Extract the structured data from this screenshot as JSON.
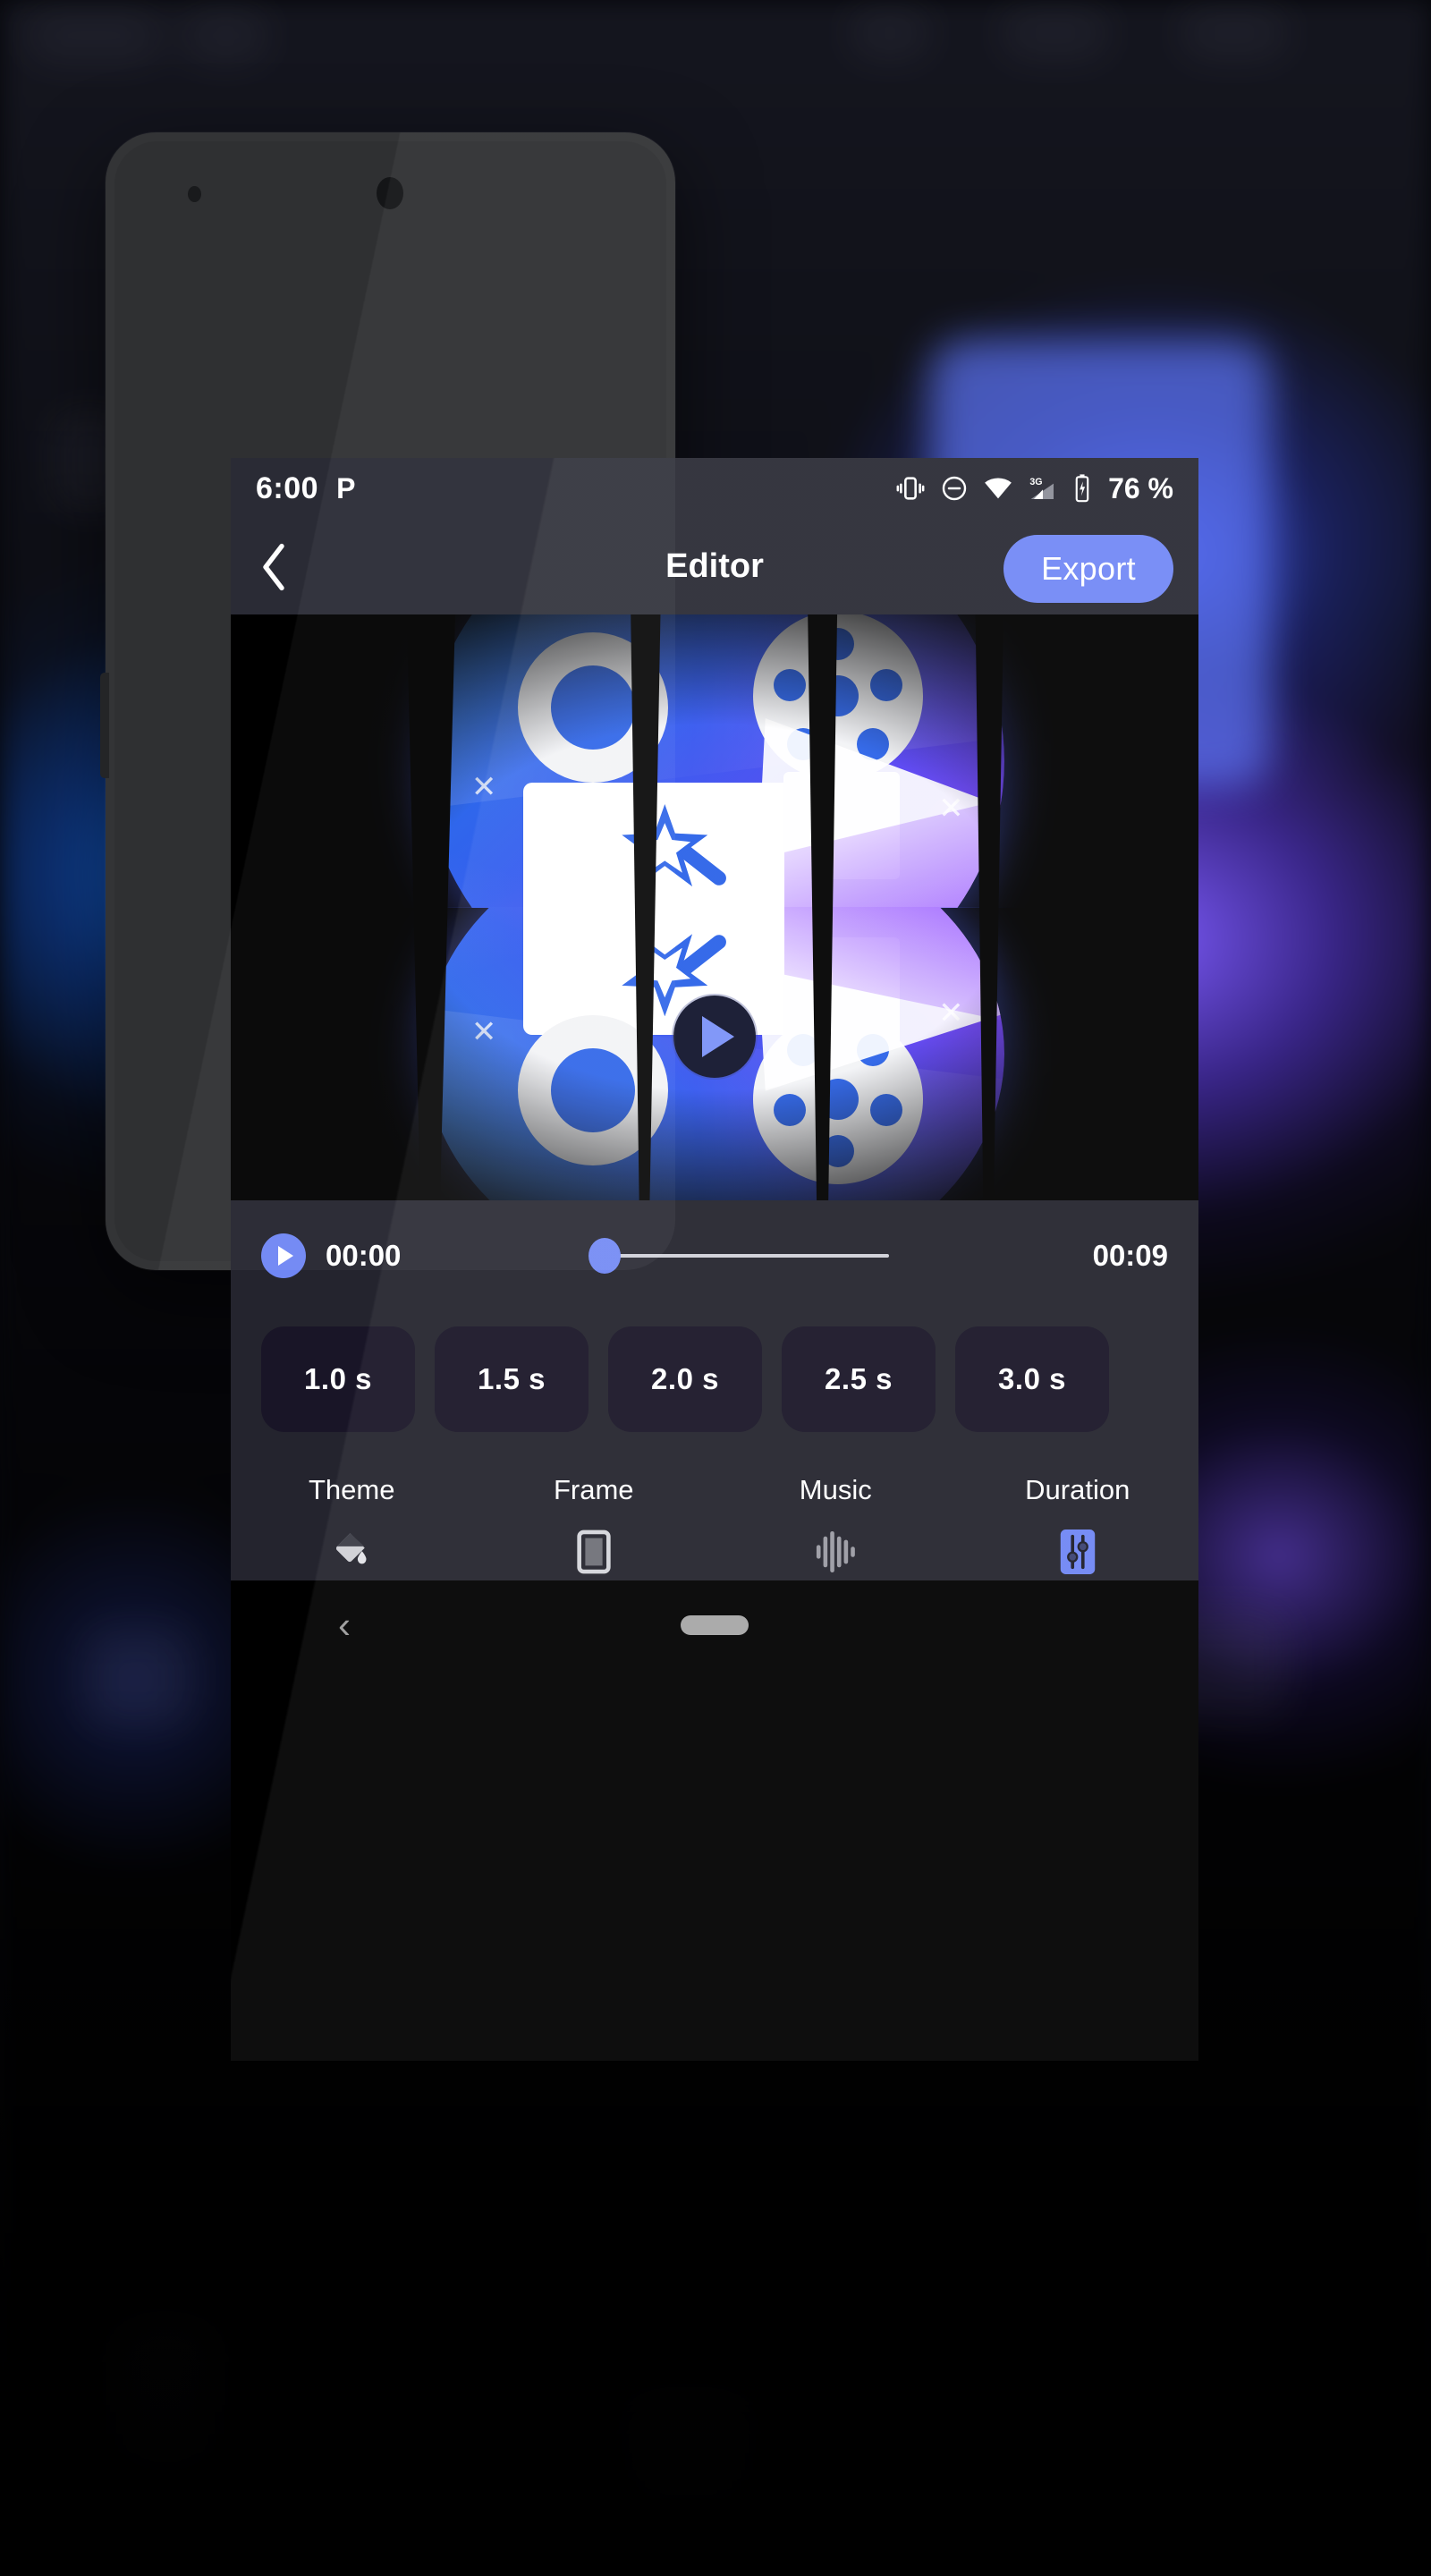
{
  "app": {
    "screen_title": "Editor"
  },
  "status_bar": {
    "time": "6:00",
    "carrier_glyph": "P",
    "battery_percent": "76 %",
    "icons": [
      "vibrate-icon",
      "do-not-disturb-icon",
      "wifi-icon",
      "cellular-3g-icon",
      "battery-icon"
    ],
    "network_label": "3G"
  },
  "app_bar": {
    "back_label": "‹",
    "title": "Editor",
    "export_label": "Export",
    "export_color": "#7289F5"
  },
  "preview": {
    "play_button_label": "play-overlay",
    "accent_color": "#7B92F8"
  },
  "timeline": {
    "play_label": "play",
    "current_time": "00:00",
    "total_time": "00:09",
    "progress_percent": 0,
    "knob_color": "#6F86F4",
    "prefill_color": "#B06CF0"
  },
  "duration_chips": [
    {
      "label": "1.0 s",
      "selected": false
    },
    {
      "label": "1.5 s",
      "selected": false
    },
    {
      "label": "2.0 s",
      "selected": false
    },
    {
      "label": "2.5 s",
      "selected": false
    },
    {
      "label": "3.0 s",
      "selected": false
    }
  ],
  "tabs": [
    {
      "label": "Theme",
      "icon": "paint-bucket-icon",
      "active": false
    },
    {
      "label": "Frame",
      "icon": "frame-icon",
      "active": false
    },
    {
      "label": "Music",
      "icon": "waveform-icon",
      "active": false
    },
    {
      "label": "Duration",
      "icon": "sliders-icon",
      "active": true
    }
  ],
  "nav_bar": {
    "back_label": "‹",
    "home_pill": "home-pill"
  },
  "theme": {
    "screen_bg": "#24242E",
    "appbar_bg": "#2A2B35",
    "chip_bg": "#191527",
    "accent": "#7289F5",
    "phone_body": "#333436"
  }
}
